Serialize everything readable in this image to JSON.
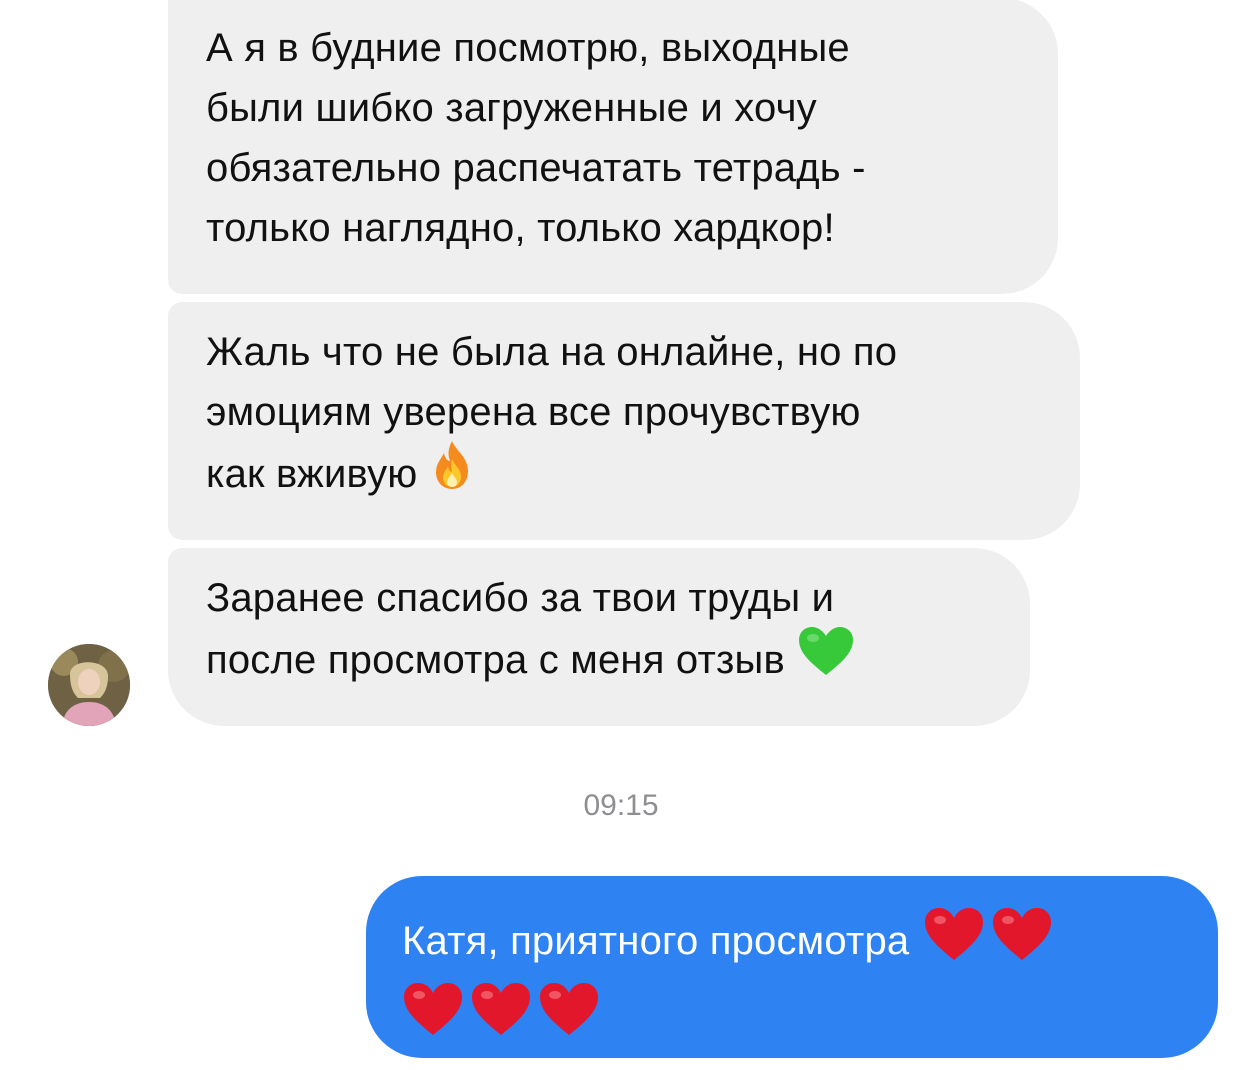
{
  "conversation": {
    "incoming": [
      {
        "lines": [
          "А я в будние посмотрю, выходные",
          "были шибко загруженные и хочу",
          "обязательно распечатать тетрадь -",
          "только наглядно, только хардкор!"
        ]
      },
      {
        "lines": [
          "Жаль что не была на онлайне, но по",
          "эмоциям уверена все прочувствую",
          "как вживую"
        ],
        "emoji_icon": "fire-icon"
      },
      {
        "lines": [
          "Заранее спасибо за твои труды и",
          "после просмотра с меня отзыв"
        ],
        "emoji_icon": "green-heart-icon"
      }
    ],
    "timestamp": "09:15",
    "outgoing": [
      {
        "text": "Катя, приятного просмотра",
        "emoji_icon": "red-heart-icon",
        "emoji_count": 5
      }
    ]
  },
  "avatar_icon": "user-avatar-photo",
  "colors": {
    "incoming_bubble": "#efefef",
    "outgoing_bubble": "#2e82f2",
    "timestamp_text": "#8e8e93",
    "heart_red": "#e3172b",
    "heart_green": "#38c93a",
    "fire_orange": "#f58a1f"
  }
}
